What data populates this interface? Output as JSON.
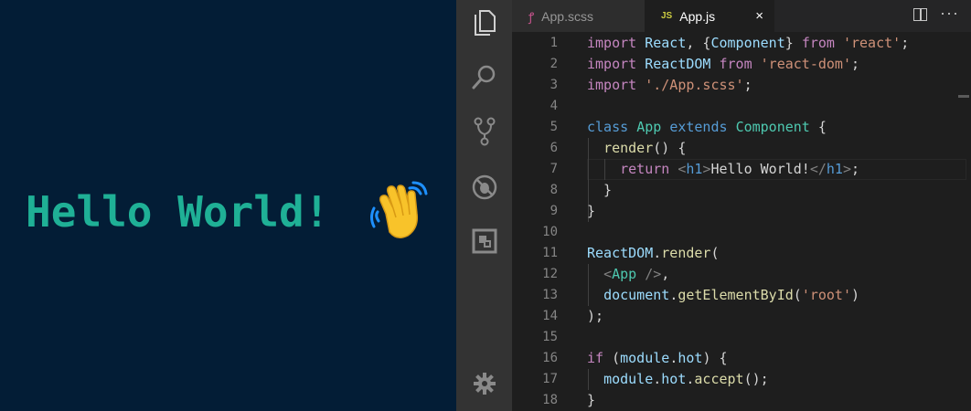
{
  "preview": {
    "greeting": "Hello World!"
  },
  "activity_bar": {
    "items": [
      {
        "name": "explorer-icon"
      },
      {
        "name": "search-icon"
      },
      {
        "name": "source-control-icon"
      },
      {
        "name": "debug-icon"
      },
      {
        "name": "extensions-icon"
      },
      {
        "name": "settings-gear-icon"
      }
    ]
  },
  "tabs": [
    {
      "label": "App.scss",
      "icon": "sass-icon",
      "active": false
    },
    {
      "label": "App.js",
      "badge": "JS",
      "active": true,
      "close": "×"
    }
  ],
  "tab_actions": {
    "more": "···"
  },
  "editor": {
    "lines": [
      {
        "n": "1",
        "tokens": [
          [
            "k",
            "import"
          ],
          [
            "p",
            " "
          ],
          [
            "v",
            "React"
          ],
          [
            "p",
            ", {"
          ],
          [
            "v",
            "Component"
          ],
          [
            "p",
            "} "
          ],
          [
            "k",
            "from"
          ],
          [
            "p",
            " "
          ],
          [
            "s",
            "'react'"
          ],
          [
            "p",
            ";"
          ]
        ]
      },
      {
        "n": "2",
        "tokens": [
          [
            "k",
            "import"
          ],
          [
            "p",
            " "
          ],
          [
            "v",
            "ReactDOM"
          ],
          [
            "p",
            " "
          ],
          [
            "k",
            "from"
          ],
          [
            "p",
            " "
          ],
          [
            "s",
            "'react-dom'"
          ],
          [
            "p",
            ";"
          ]
        ]
      },
      {
        "n": "3",
        "tokens": [
          [
            "k",
            "import"
          ],
          [
            "p",
            " "
          ],
          [
            "s",
            "'./App.scss'"
          ],
          [
            "p",
            ";"
          ]
        ]
      },
      {
        "n": "4",
        "tokens": []
      },
      {
        "n": "5",
        "tokens": [
          [
            "kb",
            "class"
          ],
          [
            "p",
            " "
          ],
          [
            "t",
            "App"
          ],
          [
            "p",
            " "
          ],
          [
            "kb",
            "extends"
          ],
          [
            "p",
            " "
          ],
          [
            "t",
            "Component"
          ],
          [
            "p",
            " {"
          ]
        ]
      },
      {
        "n": "6",
        "tokens": [
          [
            "p",
            "  "
          ],
          [
            "f",
            "render"
          ],
          [
            "p",
            "() {"
          ]
        ]
      },
      {
        "n": "7",
        "tokens": [
          [
            "p",
            "    "
          ],
          [
            "k",
            "return"
          ],
          [
            "p",
            " "
          ],
          [
            "g",
            "<"
          ],
          [
            "kb",
            "h1"
          ],
          [
            "g",
            ">"
          ],
          [
            "p",
            "Hello World!"
          ],
          [
            "g",
            "</"
          ],
          [
            "kb",
            "h1"
          ],
          [
            "g",
            ">"
          ],
          [
            "p",
            ";"
          ]
        ]
      },
      {
        "n": "8",
        "tokens": [
          [
            "p",
            "  }"
          ]
        ]
      },
      {
        "n": "9",
        "tokens": [
          [
            "p",
            "}"
          ]
        ]
      },
      {
        "n": "10",
        "tokens": []
      },
      {
        "n": "11",
        "tokens": [
          [
            "v",
            "ReactDOM"
          ],
          [
            "p",
            "."
          ],
          [
            "f",
            "render"
          ],
          [
            "p",
            "("
          ]
        ]
      },
      {
        "n": "12",
        "tokens": [
          [
            "p",
            "  "
          ],
          [
            "g",
            "<"
          ],
          [
            "t",
            "App"
          ],
          [
            "p",
            " "
          ],
          [
            "g",
            "/>"
          ],
          [
            "p",
            ","
          ]
        ]
      },
      {
        "n": "13",
        "tokens": [
          [
            "p",
            "  "
          ],
          [
            "v",
            "document"
          ],
          [
            "p",
            "."
          ],
          [
            "f",
            "getElementById"
          ],
          [
            "p",
            "("
          ],
          [
            "s",
            "'root'"
          ],
          [
            "p",
            ")"
          ]
        ]
      },
      {
        "n": "14",
        "tokens": [
          [
            "p",
            ");"
          ]
        ]
      },
      {
        "n": "15",
        "tokens": []
      },
      {
        "n": "16",
        "tokens": [
          [
            "k",
            "if"
          ],
          [
            "p",
            " ("
          ],
          [
            "v",
            "module"
          ],
          [
            "p",
            "."
          ],
          [
            "v",
            "hot"
          ],
          [
            "p",
            ") {"
          ]
        ]
      },
      {
        "n": "17",
        "tokens": [
          [
            "p",
            "  "
          ],
          [
            "v",
            "module"
          ],
          [
            "p",
            "."
          ],
          [
            "v",
            "hot"
          ],
          [
            "p",
            "."
          ],
          [
            "f",
            "accept"
          ],
          [
            "p",
            "();"
          ]
        ]
      },
      {
        "n": "18",
        "tokens": [
          [
            "p",
            "}"
          ]
        ]
      }
    ]
  }
}
